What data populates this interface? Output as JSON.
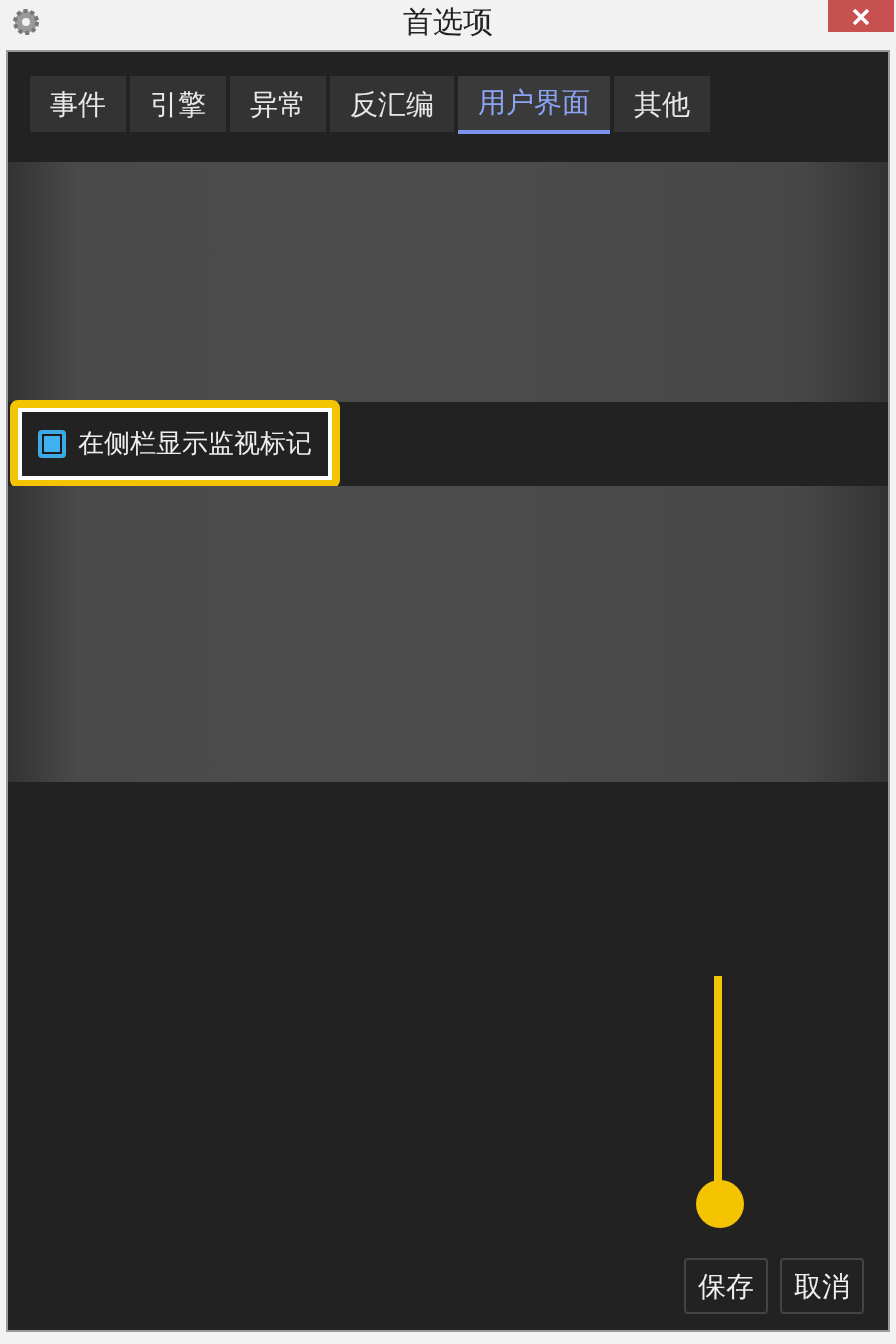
{
  "window": {
    "title": "首选项"
  },
  "tabs": [
    {
      "label": "事件",
      "selected": false
    },
    {
      "label": "引擎",
      "selected": false
    },
    {
      "label": "异常",
      "selected": false
    },
    {
      "label": "反汇编",
      "selected": false
    },
    {
      "label": "用户界面",
      "selected": true
    },
    {
      "label": "其他",
      "selected": false
    }
  ],
  "option": {
    "label": "在侧栏显示监视标记",
    "checked": true
  },
  "buttons": [
    {
      "label": "保存"
    },
    {
      "label": "取消"
    }
  ]
}
